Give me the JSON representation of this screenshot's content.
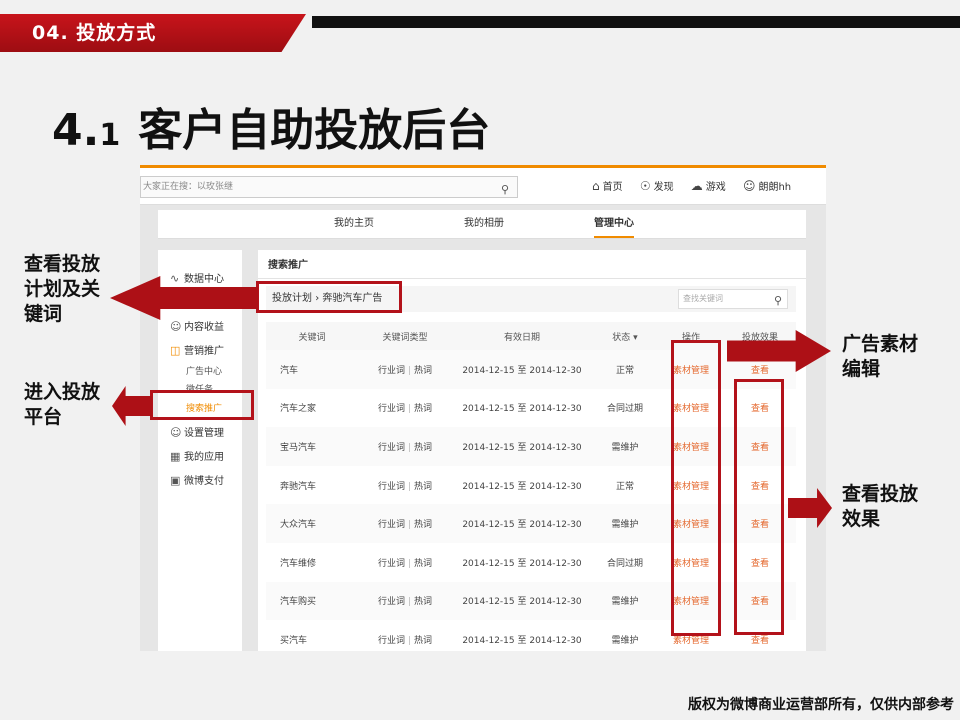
{
  "slide": {
    "section_tag": "04. 投放方式",
    "title_num_big": "4.",
    "title_num_small": "1",
    "title_text": "客户自助投放后台",
    "footer": "版权为微博商业运营部所有，仅供内部参考"
  },
  "callouts": {
    "left_top": [
      "查看投放",
      "计划及关",
      "键词"
    ],
    "left_bottom": [
      "进入投放",
      "平台"
    ],
    "right_top": [
      "广告素材",
      "编辑"
    ],
    "right_bottom": [
      "查看投放",
      "效果"
    ]
  },
  "topnav": {
    "search_placeholder": "大家正在搜：以玫张继",
    "links": [
      {
        "icon": "home-icon",
        "label": "首页"
      },
      {
        "icon": "compass-icon",
        "label": "发现"
      },
      {
        "icon": "game-icon",
        "label": "游戏"
      },
      {
        "icon": "user-icon",
        "label": "朗朗hh"
      }
    ]
  },
  "tabs": [
    "我的主页",
    "我的相册",
    "管理中心"
  ],
  "sidebar": {
    "items": [
      {
        "icon": "chart-icon",
        "label": "数据中心"
      },
      {
        "icon": "user-icon",
        "label": "内容收益"
      },
      {
        "icon": "bag-icon",
        "label": "营销推广"
      },
      {
        "icon": "settings-user-icon",
        "label": "设置管理"
      },
      {
        "icon": "apps-icon",
        "label": "我的应用"
      },
      {
        "icon": "wallet-icon",
        "label": "微博支付"
      }
    ],
    "subitems": [
      "广告中心",
      "微任务",
      "搜索推广"
    ]
  },
  "main": {
    "title": "搜索推广",
    "breadcrumb": {
      "parent": "投放计划",
      "separator": "›",
      "current": "奔驰汽车广告"
    },
    "keyword_search_placeholder": "查找关键词",
    "columns": [
      "关键词",
      "关键词类型",
      "有效日期",
      "状态 ▾",
      "操作",
      "投放效果"
    ],
    "rows": [
      {
        "keyword": "汽车",
        "type_a": "行业词",
        "type_b": "热词",
        "date": "2014-12-15 至 2014-12-30",
        "status": "正常",
        "action": "素材管理",
        "effect": "查看"
      },
      {
        "keyword": "汽车之家",
        "type_a": "行业词",
        "type_b": "热词",
        "date": "2014-12-15 至 2014-12-30",
        "status": "合同过期",
        "action": "素材管理",
        "effect": "查看"
      },
      {
        "keyword": "宝马汽车",
        "type_a": "行业词",
        "type_b": "热词",
        "date": "2014-12-15 至 2014-12-30",
        "status": "需维护",
        "action": "素材管理",
        "effect": "查看"
      },
      {
        "keyword": "奔驰汽车",
        "type_a": "行业词",
        "type_b": "热词",
        "date": "2014-12-15 至 2014-12-30",
        "status": "正常",
        "action": "素材管理",
        "effect": "查看"
      },
      {
        "keyword": "大众汽车",
        "type_a": "行业词",
        "type_b": "热词",
        "date": "2014-12-15 至 2014-12-30",
        "status": "需维护",
        "action": "素材管理",
        "effect": "查看"
      },
      {
        "keyword": "汽车维修",
        "type_a": "行业词",
        "type_b": "热词",
        "date": "2014-12-15 至 2014-12-30",
        "status": "合同过期",
        "action": "素材管理",
        "effect": "查看"
      },
      {
        "keyword": "汽车购买",
        "type_a": "行业词",
        "type_b": "热词",
        "date": "2014-12-15 至 2014-12-30",
        "status": "需维护",
        "action": "素材管理",
        "effect": "查看"
      },
      {
        "keyword": "买汽车",
        "type_a": "行业词",
        "type_b": "热词",
        "date": "2014-12-15 至 2014-12-30",
        "status": "需维护",
        "action": "素材管理",
        "effect": "查看"
      }
    ]
  },
  "colors": {
    "accent": "#f08b00",
    "brand_red": "#b3121a",
    "link": "#e4672c"
  }
}
